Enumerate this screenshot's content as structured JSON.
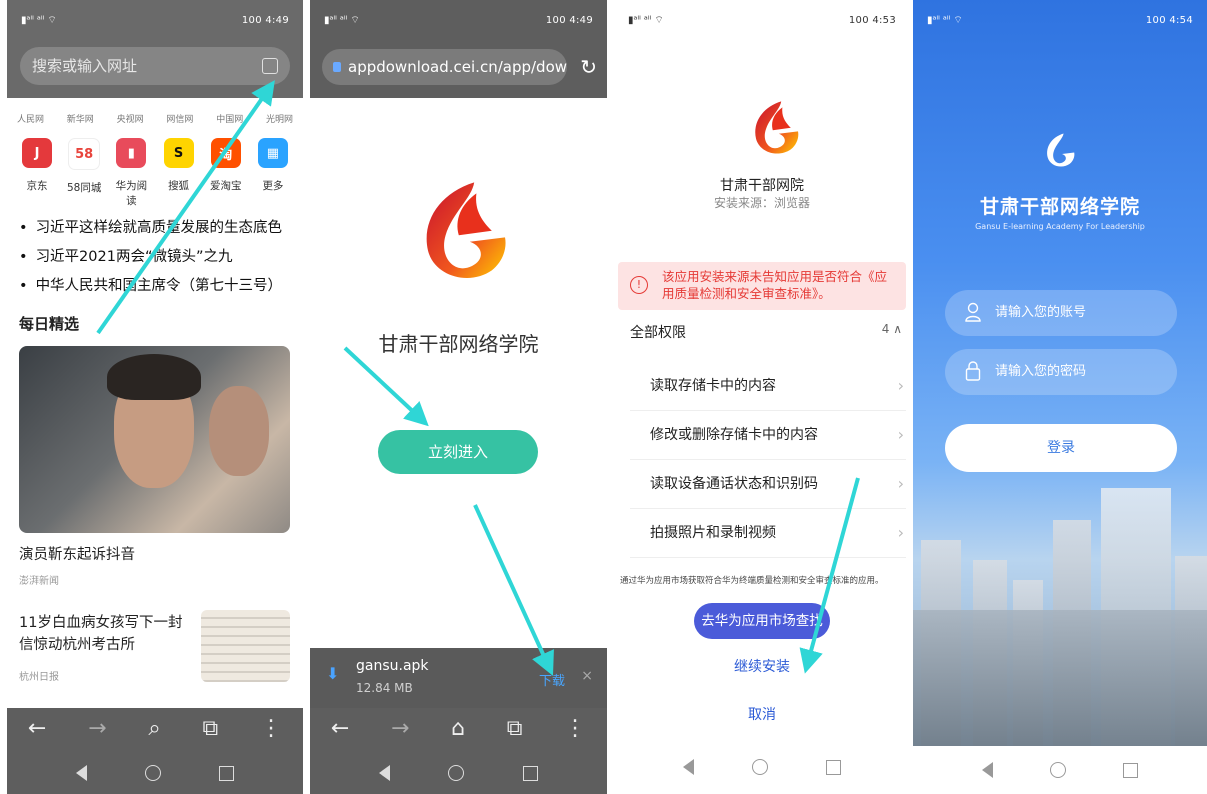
{
  "panel1": {
    "status_right": "100 4:49",
    "search_placeholder": "搜索或输入网址",
    "sites": [
      "人民网",
      "新华网",
      "央视网",
      "网信网",
      "中国网",
      "光明网"
    ],
    "apps": [
      {
        "label": "京东",
        "color": "#e4393c",
        "glyph": "J"
      },
      {
        "label": "58同城",
        "color": "#ffffff",
        "glyph": "58"
      },
      {
        "label": "华为阅读",
        "color": "#e84b5b",
        "glyph": "▮"
      },
      {
        "label": "搜狐",
        "color": "#ffd400",
        "glyph": "S"
      },
      {
        "label": "爱淘宝",
        "color": "#ff5000",
        "glyph": "淘"
      },
      {
        "label": "更多",
        "color": "#2aa3ff",
        "glyph": "▦"
      }
    ],
    "news": [
      "习近平这样绘就高质量发展的生态底色",
      "习近平2021两会“微镜头”之九",
      "中华人民共和国主席令（第七十三号）"
    ],
    "section_title": "每日精选",
    "article1_title": "演员靳东起诉抖音",
    "article1_source": "澎湃新闻",
    "article2_title": "11岁白血病女孩写下一封信惊动杭州考古所",
    "article2_source": "杭州日报"
  },
  "panel2": {
    "status_right": "100 4:49",
    "url": "appdownload.cei.cn/app/downloa",
    "app_name": "甘肃干部网络学院",
    "enter_label": "立刻进入",
    "file_name": "gansu.apk",
    "file_size": "12.84 MB",
    "download_label": "下载",
    "close_label": "×"
  },
  "panel3": {
    "status_right": "100 4:53",
    "app_name": "甘肃干部网院",
    "install_source": "安装来源：浏览器",
    "warning": "该应用安装来源未告知应用是否符合《应用质量检测和安全审查标准》。",
    "permissions_header": "全部权限",
    "permissions_count": "4 ∧",
    "permissions": [
      "读取存储卡中的内容",
      "修改或删除存储卡中的内容",
      "读取设备通话状态和识别码",
      "拍摄照片和录制视频"
    ],
    "fine_print": "通过华为应用市场获取符合华为终端质量检测和安全审查标准的应用。",
    "market_button": "去华为应用市场查找",
    "continue_label": "继续安装",
    "cancel_label": "取消"
  },
  "panel4": {
    "status_right": "100 4:54",
    "title": "甘肃干部网络学院",
    "subtitle": "Gansu E-learning Academy For Leadership",
    "account_placeholder": "请输入您的账号",
    "password_placeholder": "请输入您的密码",
    "login_label": "登录"
  },
  "colors": {
    "accent_green": "#36c2a3",
    "huawei_blue": "#4b5bd9",
    "link_blue": "#2c5bd6",
    "arrow_cyan": "#2fd6d6",
    "warning_red": "#e53935"
  }
}
